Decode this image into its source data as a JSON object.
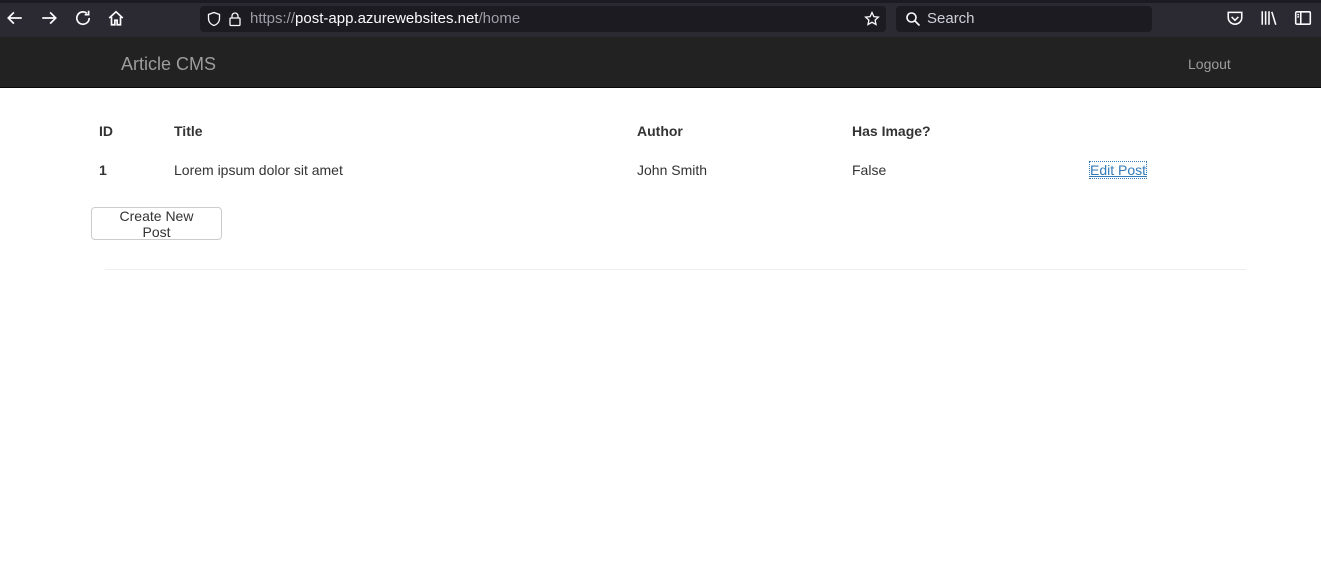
{
  "browser": {
    "url_scheme": "https://",
    "url_host": "post-app.azurewebsites.net",
    "url_path": "/home",
    "search_placeholder": "Search",
    "icons": [
      "back-arrow-icon",
      "forward-arrow-icon",
      "reload-icon",
      "home-icon",
      "shield-icon",
      "lock-icon",
      "bookmark-star-icon",
      "search-icon",
      "pocket-icon",
      "library-icon",
      "sidebar-icon"
    ]
  },
  "navbar": {
    "brand": "Article CMS",
    "logout": "Logout",
    "background": "#222222"
  },
  "table": {
    "headers": [
      "ID",
      "Title",
      "Author",
      "Has Image?",
      ""
    ],
    "rows": [
      {
        "id": "1",
        "title": "Lorem ipsum dolor sit amet",
        "author": "John Smith",
        "has_image": "False",
        "action": "Edit Post"
      }
    ]
  },
  "actions": {
    "create_label": "Create New Post"
  },
  "colors": {
    "link": "#337ab7",
    "text": "#333333"
  }
}
